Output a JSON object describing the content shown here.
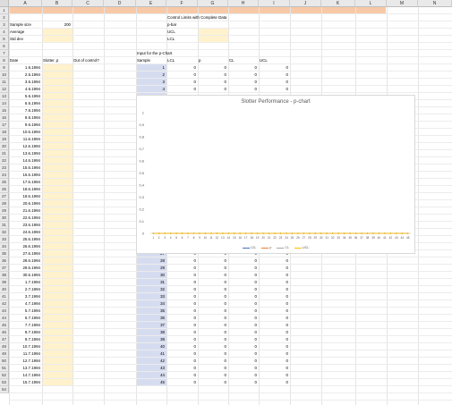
{
  "columns": [
    "A",
    "B",
    "C",
    "D",
    "E",
    "F",
    "G",
    "H",
    "I",
    "J",
    "K",
    "L",
    "M",
    "N"
  ],
  "rows_visible": 54,
  "summary": {
    "sample_size_label": "Sample size",
    "sample_size_value": "200",
    "average_label": "Average",
    "std_dev_label": "Std dev"
  },
  "control_limits": {
    "title": "Control Limits with Complete Data",
    "pbar": "p-bar",
    "ucl": "UCL",
    "lcl": "LCL"
  },
  "input_title": "Input for the p-Chart",
  "headers": {
    "date": "Date",
    "slotter": "Slotter, p",
    "out_of_control": "Out of control?",
    "sample": "Sample",
    "lcl": "LCL",
    "p": "p",
    "cl": "CL",
    "ucl": "UCL"
  },
  "dates": [
    "1.6.1994",
    "2.6.1994",
    "3.6.1994",
    "4.6.1994",
    "5.6.1994",
    "6.6.1994",
    "7.6.1994",
    "8.6.1994",
    "9.6.1994",
    "10.6.1994",
    "11.6.1994",
    "12.6.1994",
    "13.6.1994",
    "14.6.1994",
    "15.6.1994",
    "16.6.1994",
    "17.6.1994",
    "18.6.1994",
    "19.6.1994",
    "20.6.1994",
    "21.6.1994",
    "22.6.1994",
    "23.6.1994",
    "24.6.1994",
    "25.6.1994",
    "26.6.1994",
    "27.6.1994",
    "28.6.1994",
    "29.6.1994",
    "30.6.1994",
    "1.7.1994",
    "2.7.1994",
    "3.7.1994",
    "4.7.1994",
    "5.7.1994",
    "6.7.1994",
    "7.7.1994",
    "8.7.1994",
    "9.7.1994",
    "10.7.1994",
    "11.7.1994",
    "12.7.1994",
    "13.7.1994",
    "14.7.1994",
    "15.7.1994"
  ],
  "zero": "0",
  "chart_data": {
    "type": "line",
    "title": "Slotter Performance - p-chart",
    "x": [
      1,
      2,
      3,
      4,
      5,
      6,
      7,
      8,
      9,
      10,
      11,
      12,
      13,
      14,
      15,
      16,
      17,
      18,
      19,
      20,
      21,
      22,
      23,
      24,
      25,
      26,
      27,
      28,
      29,
      30,
      31,
      32,
      33,
      34,
      35,
      36,
      37,
      38,
      39,
      40,
      41,
      42,
      43,
      44,
      45
    ],
    "series": [
      {
        "name": "LCL",
        "values": [
          0,
          0,
          0,
          0,
          0,
          0,
          0,
          0,
          0,
          0,
          0,
          0,
          0,
          0,
          0,
          0,
          0,
          0,
          0,
          0,
          0,
          0,
          0,
          0,
          0,
          0,
          0,
          0,
          0,
          0,
          0,
          0,
          0,
          0,
          0,
          0,
          0,
          0,
          0,
          0,
          0,
          0,
          0,
          0,
          0
        ],
        "color": "#4472c4"
      },
      {
        "name": "p",
        "values": [
          0,
          0,
          0,
          0,
          0,
          0,
          0,
          0,
          0,
          0,
          0,
          0,
          0,
          0,
          0,
          0,
          0,
          0,
          0,
          0,
          0,
          0,
          0,
          0,
          0,
          0,
          0,
          0,
          0,
          0,
          0,
          0,
          0,
          0,
          0,
          0,
          0,
          0,
          0,
          0,
          0,
          0,
          0,
          0,
          0
        ],
        "color": "#ed7d31"
      },
      {
        "name": "CL",
        "values": [
          0,
          0,
          0,
          0,
          0,
          0,
          0,
          0,
          0,
          0,
          0,
          0,
          0,
          0,
          0,
          0,
          0,
          0,
          0,
          0,
          0,
          0,
          0,
          0,
          0,
          0,
          0,
          0,
          0,
          0,
          0,
          0,
          0,
          0,
          0,
          0,
          0,
          0,
          0,
          0,
          0,
          0,
          0,
          0,
          0
        ],
        "color": "#a5a5a5"
      },
      {
        "name": "UCL",
        "values": [
          0,
          0,
          0,
          0,
          0,
          0,
          0,
          0,
          0,
          0,
          0,
          0,
          0,
          0,
          0,
          0,
          0,
          0,
          0,
          0,
          0,
          0,
          0,
          0,
          0,
          0,
          0,
          0,
          0,
          0,
          0,
          0,
          0,
          0,
          0,
          0,
          0,
          0,
          0,
          0,
          0,
          0,
          0,
          0,
          0
        ],
        "color": "#ffc000"
      }
    ],
    "yticks": [
      "0",
      "0,1",
      "0,2",
      "0,3",
      "0,4",
      "0,5",
      "0,6",
      "0,7",
      "0,8",
      "0,9",
      "1"
    ],
    "ylim": [
      0,
      1
    ],
    "grid": false,
    "legend": "bottom"
  }
}
